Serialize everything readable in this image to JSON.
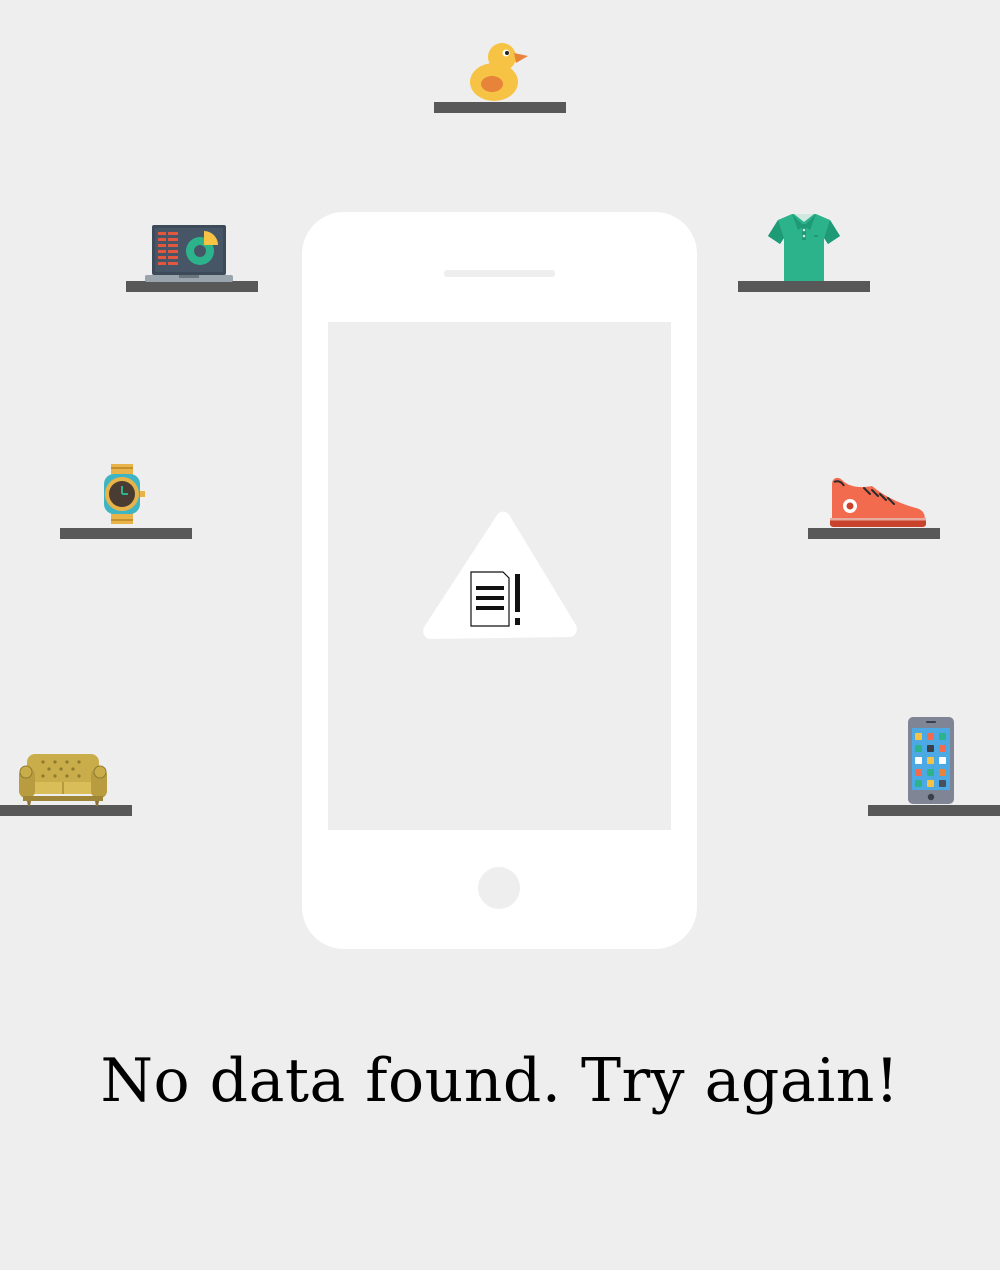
{
  "empty_state": {
    "message": "No data found. Try again!"
  },
  "illustration": {
    "icons": [
      "rubber-duck-icon",
      "laptop-chart-icon",
      "polo-shirt-icon",
      "wristwatch-icon",
      "sneaker-icon",
      "armchair-sofa-icon",
      "smartphone-apps-icon",
      "document-warning-icon"
    ],
    "colors": {
      "background": "#eeeeee",
      "shelf": "#585858",
      "phone_body": "#ffffff",
      "duck": "#f6c344",
      "shirt": "#2db38c",
      "sneaker": "#f36b4f",
      "sofa": "#c9ad4a"
    }
  }
}
